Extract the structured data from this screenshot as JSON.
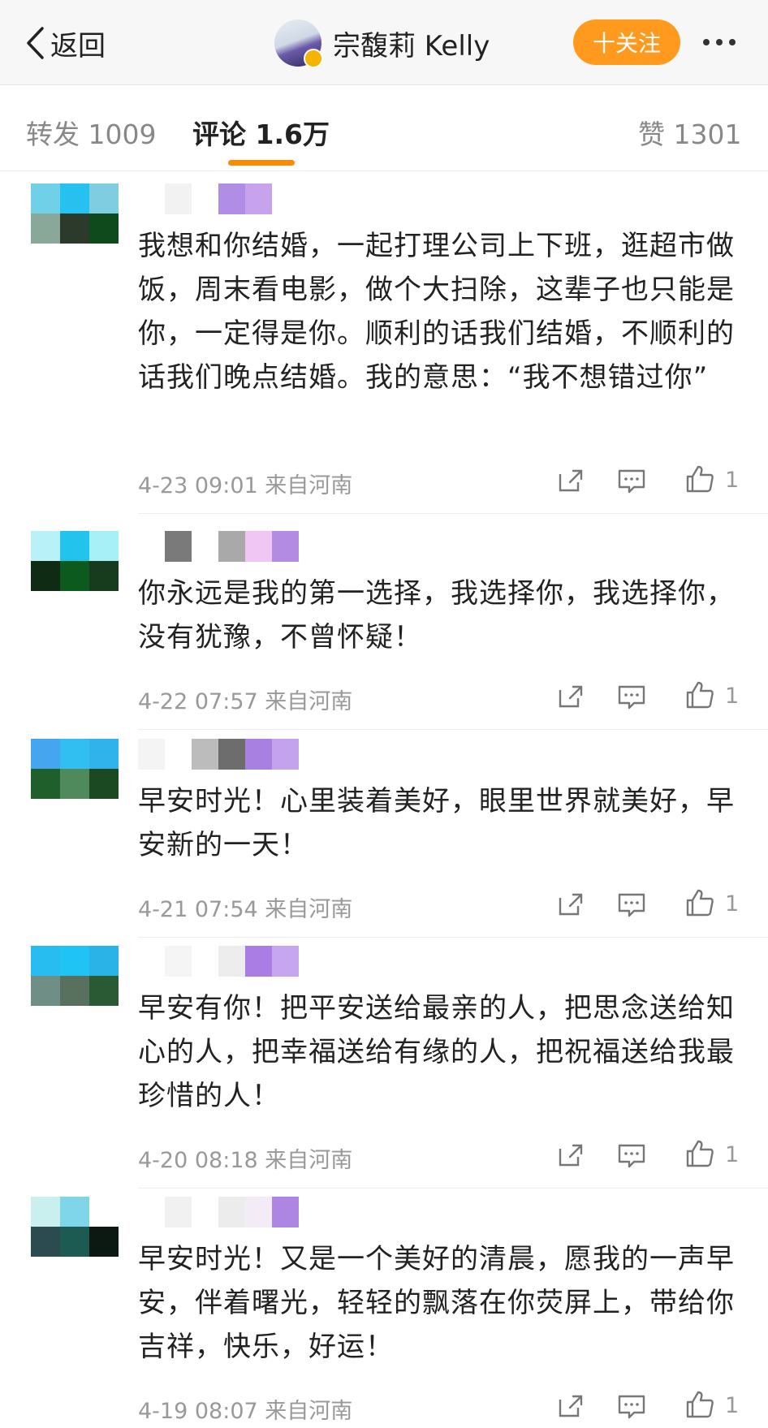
{
  "header": {
    "back_label": "返回",
    "author_name": "宗馥莉 Kelly",
    "follow_label": "十关注"
  },
  "tabs": {
    "repost": "转发 1009",
    "comments": "评论 1.6万",
    "likes": "赞 1301"
  },
  "comments": [
    {
      "text": "我想和你结婚，一起打理公司上下班，逛超市做饭，周末看电影，做个大扫除，这辈子也只能是你，一定得是你。顺利的话我们结婚，不顺利的话我们晚点结婚。我的意思：“我不想错过你”",
      "time": "4-23 09:01",
      "location": "来自河南",
      "likes": "1",
      "avatar_colors": [
        "#6fd0e8",
        "#27c1f0",
        "#7fcde0",
        "#8aa89a",
        "#2c3a2c",
        "#0f4a1c"
      ],
      "name_colors": [
        "#ffffff",
        "#f2f2f2",
        "#ffffff",
        "#b18ee6",
        "#c7a3ee"
      ]
    },
    {
      "text": "你永远是我的第一选择，我选择你，我选择你，没有犹豫，不曾怀疑！",
      "time": "4-22 07:57",
      "location": "来自河南",
      "likes": "1",
      "avatar_colors": [
        "#b8f2f8",
        "#22c3ec",
        "#a8f0f7",
        "#0f2b14",
        "#0d5a1e",
        "#163b1d"
      ],
      "name_colors": [
        "#ffffff",
        "#7a7a7a",
        "#ffffff",
        "#a9a9a9",
        "#f0c6f5",
        "#b38be3"
      ]
    },
    {
      "text": "早安时光！心里装着美好，眼里世界就美好，早安新的一天！",
      "time": "4-21 07:54",
      "location": "来自河南",
      "likes": "1",
      "avatar_colors": [
        "#45a6ef",
        "#30bff0",
        "#2fb3ea",
        "#1f5f2b",
        "#4f8a5c",
        "#1b4a22"
      ],
      "name_colors": [
        "#f4f4f4",
        "#ffffff",
        "#bcbcbc",
        "#6d6d6d",
        "#a880e2",
        "#c3a4ec"
      ]
    },
    {
      "text": "早安有你！把平安送给最亲的人，把思念送给知心的人，把幸福送给有缘的人，把祝福送给我最珍惜的人！",
      "time": "4-20 08:18",
      "location": "来自河南",
      "likes": "1",
      "avatar_colors": [
        "#27bdf0",
        "#1fc3f4",
        "#29b3e6",
        "#6f8f86",
        "#58705e",
        "#2a5a33"
      ],
      "name_colors": [
        "#ffffff",
        "#f5f5f5",
        "#ffffff",
        "#ededed",
        "#a97de4",
        "#c5a6ef"
      ]
    },
    {
      "text": "早安时光！又是一个美好的清晨，愿我的一声早安，伴着曙光，轻轻的飘落在你荧屏上，带给你吉祥，快乐，好运！",
      "time": "4-19 08:07",
      "location": "来自河南",
      "likes": "1",
      "avatar_colors": [
        "#c9f0ef",
        "#7fd6e8",
        "#ffffff",
        "#2c4b50",
        "#1d5a52",
        "#0c1812"
      ],
      "name_colors": [
        "#ffffff",
        "#f1f1f1",
        "#ffffff",
        "#ececec",
        "#f3ecf7",
        "#ad86e3"
      ]
    }
  ]
}
